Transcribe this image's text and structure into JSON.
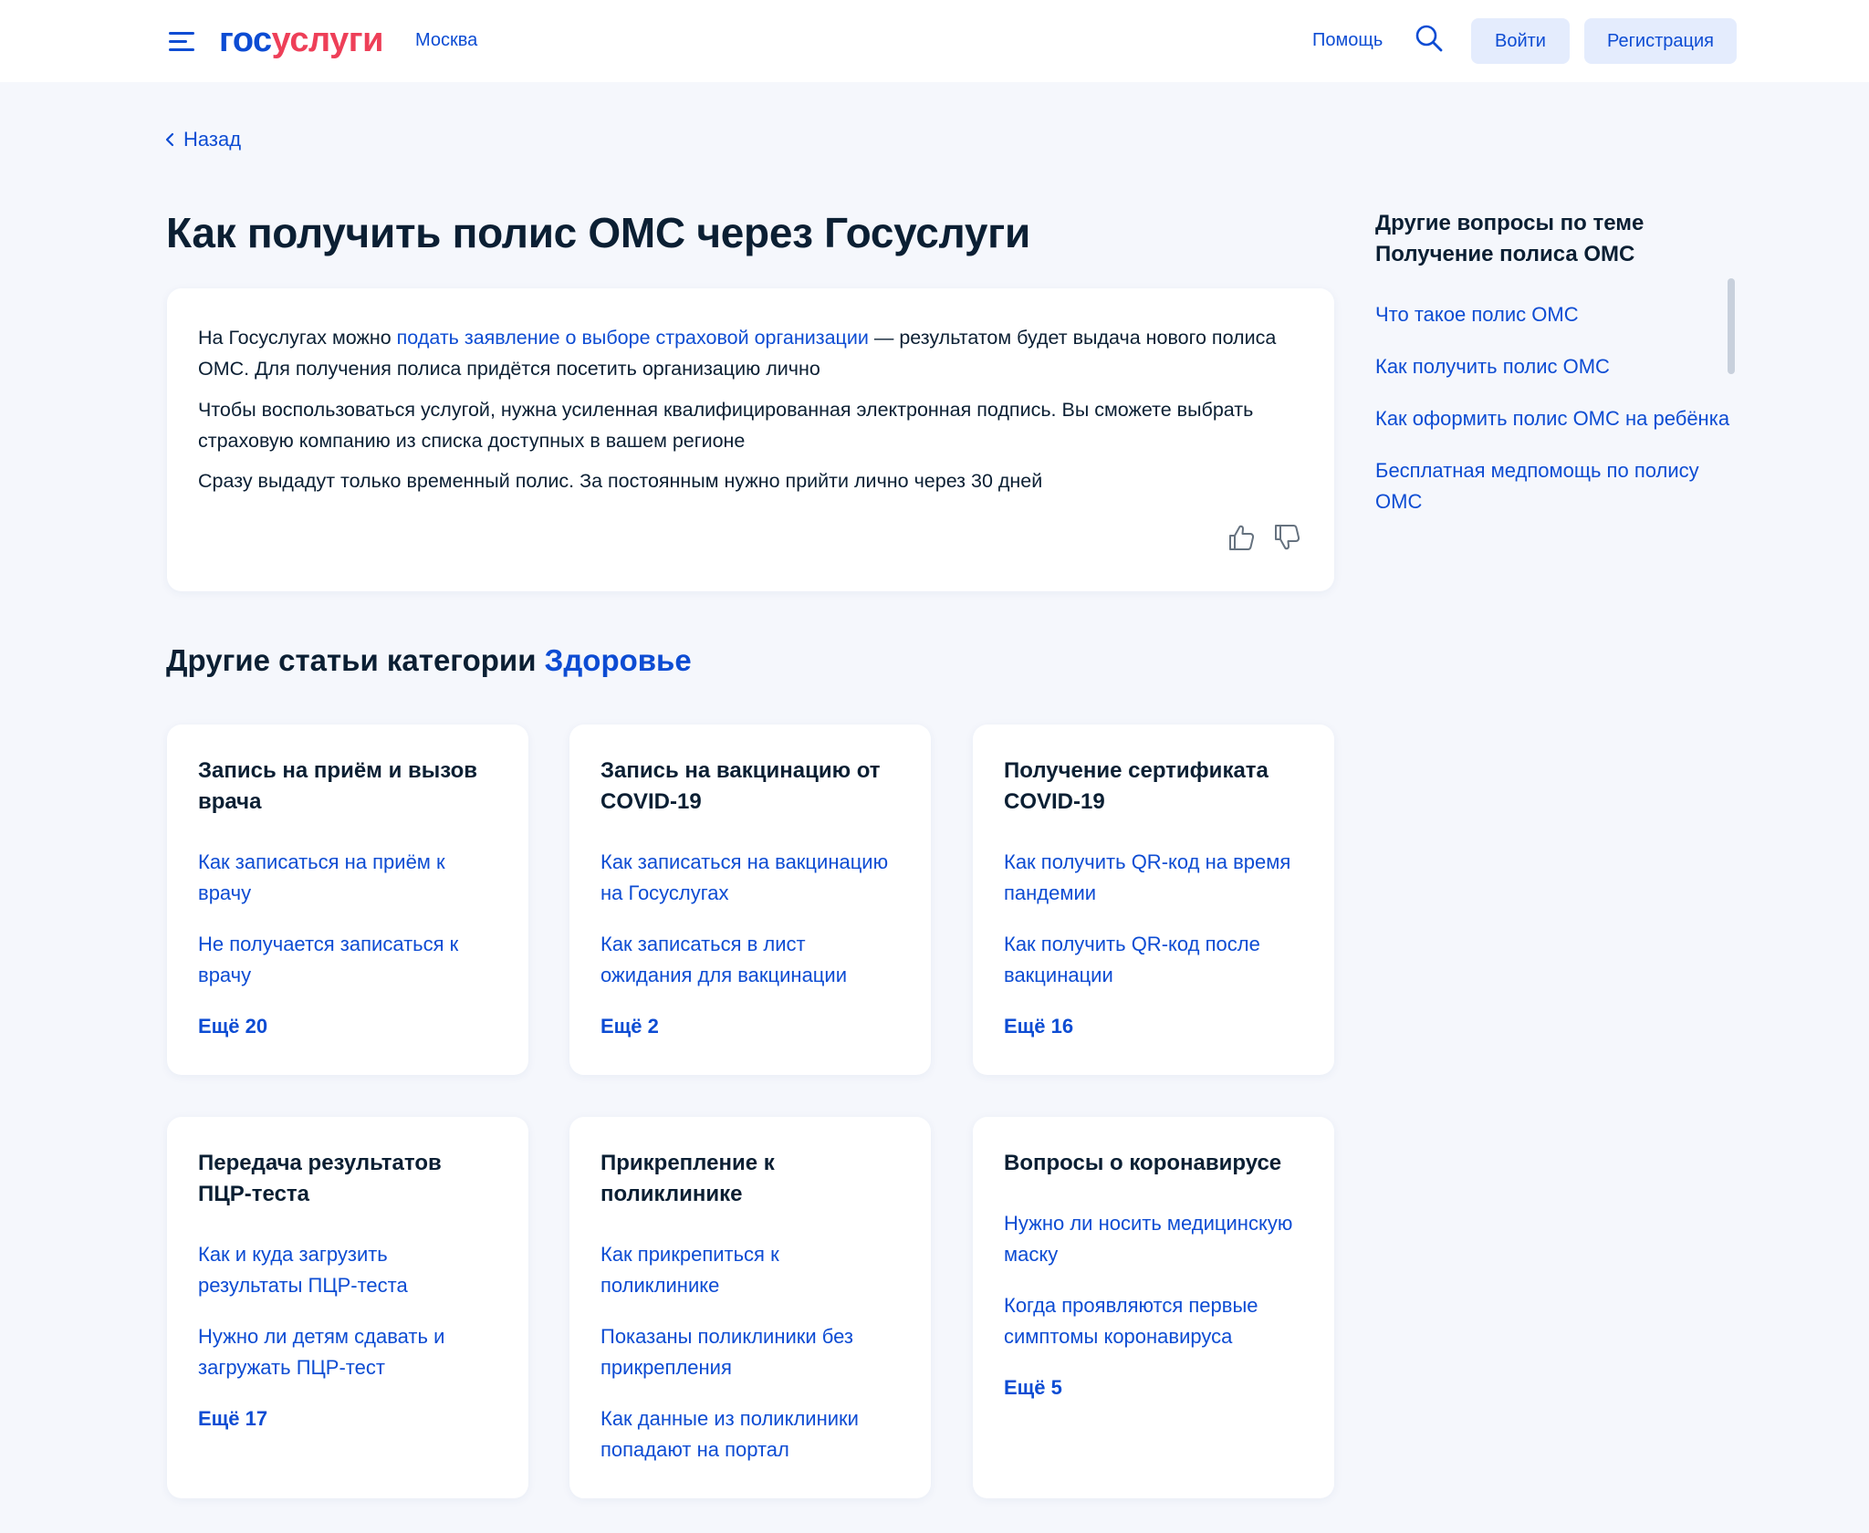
{
  "header": {
    "logo_part1": "гос",
    "logo_part2": "услуги",
    "city": "Москва",
    "help": "Помощь",
    "login": "Войти",
    "register": "Регистрация"
  },
  "nav": {
    "back": "Назад"
  },
  "article": {
    "title": "Как получить полис ОМС через Госуслуги",
    "p1_before": "На Госуслугах можно ",
    "p1_link": "подать заявление о выборе страховой организации",
    "p1_after": " — результатом будет выдача нового полиса ОМС. Для получения полиса придётся посетить организацию лично",
    "p2": "Чтобы воспользоваться услугой, нужна усиленная квалифицированная электронная подпись. Вы сможете выбрать страховую компанию из списка доступных в вашем регионе",
    "p3": "Сразу выдадут только временный полис. За постоянным нужно прийти лично через 30 дней"
  },
  "sidebar": {
    "title": "Другие вопросы по теме Получение полиса ОМС",
    "links": [
      "Что такое полис ОМС",
      "Как получить полис ОМС",
      "Как оформить полис ОМС на ребёнка",
      "Бесплатная медпомощь по полису ОМС"
    ]
  },
  "section": {
    "title_prefix": "Другие статьи категории ",
    "category": "Здоровье"
  },
  "cards": [
    {
      "title": "Запись на приём и вызов врача",
      "links": [
        "Как записаться на приём к врачу",
        "Не получается записаться к врачу"
      ],
      "more": "Ещё 20"
    },
    {
      "title": "Запись на вакцинацию от COVID-19",
      "links": [
        "Как записаться на вакцинацию на Госуслугах",
        "Как записаться в лист ожидания для вакцинации"
      ],
      "more": "Ещё 2"
    },
    {
      "title": "Получение сертификата COVID-19",
      "links": [
        "Как получить QR-код на время пандемии",
        "Как получить QR-код после вакцинации"
      ],
      "more": "Ещё 16"
    },
    {
      "title": "Передача результатов ПЦР-теста",
      "links": [
        "Как и куда загрузить результаты ПЦР-теста",
        "Нужно ли детям сдавать и загружать ПЦР-тест"
      ],
      "more": "Ещё 17"
    },
    {
      "title": "Прикрепление к поликлинике",
      "links": [
        "Как прикрепиться к поликлинике",
        "Показаны поликлиники без прикрепления",
        "Как данные из поликлиники попадают на портал"
      ],
      "more": ""
    },
    {
      "title": "Вопросы о коронавирусе",
      "links": [
        "Нужно ли носить медицинскую маску",
        "Когда проявляются первые симптомы коронавируса"
      ],
      "more": "Ещё 5"
    }
  ]
}
